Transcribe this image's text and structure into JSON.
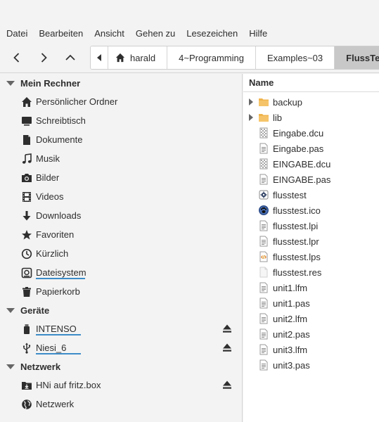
{
  "menu": [
    "Datei",
    "Bearbeiten",
    "Ansicht",
    "Gehen zu",
    "Lesezeichen",
    "Hilfe"
  ],
  "breadcrumbs": [
    "harald",
    "4~Programming",
    "Examples~03",
    "FlussTest"
  ],
  "sidebar": {
    "sections": [
      {
        "title": "Mein Rechner",
        "items": [
          {
            "label": "Persönlicher Ordner",
            "icon": "home-icon"
          },
          {
            "label": "Schreibtisch",
            "icon": "desktop-icon"
          },
          {
            "label": "Dokumente",
            "icon": "document-icon"
          },
          {
            "label": "Musik",
            "icon": "music-icon"
          },
          {
            "label": "Bilder",
            "icon": "camera-icon"
          },
          {
            "label": "Videos",
            "icon": "film-icon"
          },
          {
            "label": "Downloads",
            "icon": "download-icon"
          },
          {
            "label": "Favoriten",
            "icon": "star-icon"
          },
          {
            "label": "Kürzlich",
            "icon": "clock-icon"
          },
          {
            "label": "Dateisystem",
            "icon": "drive-icon",
            "usage": 0.44
          },
          {
            "label": "Papierkorb",
            "icon": "trash-icon"
          }
        ]
      },
      {
        "title": "Geräte",
        "items": [
          {
            "label": "INTENSO",
            "icon": "usb-drive-icon",
            "usage": 0.4,
            "eject": true
          },
          {
            "label": "Niesi_6",
            "icon": "usb-icon",
            "usage": 0.4,
            "eject": true
          }
        ]
      },
      {
        "title": "Netzwerk",
        "items": [
          {
            "label": "HNi auf fritz.box",
            "icon": "network-drive-icon",
            "eject": true
          },
          {
            "label": "Netzwerk",
            "icon": "globe-icon"
          }
        ]
      }
    ]
  },
  "filelist": {
    "column_name": "Name",
    "files": [
      {
        "name": "backup",
        "type": "folder"
      },
      {
        "name": "lib",
        "type": "folder"
      },
      {
        "name": "Eingabe.dcu",
        "type": "binary"
      },
      {
        "name": "Eingabe.pas",
        "type": "text"
      },
      {
        "name": "EINGABE.dcu",
        "type": "binary"
      },
      {
        "name": "EINGABE.pas",
        "type": "text"
      },
      {
        "name": "flusstest",
        "type": "executable"
      },
      {
        "name": "flusstest.ico",
        "type": "image"
      },
      {
        "name": "flusstest.lpi",
        "type": "text"
      },
      {
        "name": "flusstest.lpr",
        "type": "text"
      },
      {
        "name": "flusstest.lps",
        "type": "code"
      },
      {
        "name": "flusstest.res",
        "type": "blank"
      },
      {
        "name": "unit1.lfm",
        "type": "text"
      },
      {
        "name": "unit1.pas",
        "type": "text"
      },
      {
        "name": "unit2.lfm",
        "type": "text"
      },
      {
        "name": "unit2.pas",
        "type": "text"
      },
      {
        "name": "unit3.lfm",
        "type": "text"
      },
      {
        "name": "unit3.pas",
        "type": "text"
      }
    ]
  },
  "colors": {
    "folder": "#f0b44c",
    "usage_bar": "#3c8cc8",
    "active_crumb": "#c8c8c8"
  }
}
